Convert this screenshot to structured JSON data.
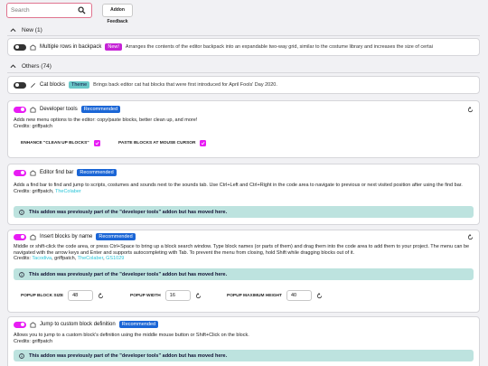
{
  "search": {
    "placeholder": "Search"
  },
  "toolbar": {
    "feedback_label": "Addon Feedback"
  },
  "sections": {
    "new_label": "New (1)",
    "others_label": "Others (74)"
  },
  "addons": [
    {
      "title": "Multiple rows in backpack",
      "badge": "New!",
      "description": "Arranges the contents of the editor backpack into an expandable two-way grid, similar to the costume library and increases the size of certain thu...",
      "enabled": false
    },
    {
      "title": "Cat blocks",
      "badge": "Theme",
      "description": "Brings back editor cat hat blocks that were first introduced for April Fools' Day 2020.",
      "enabled": false
    },
    {
      "title": "Developer tools",
      "badge": "Recommended",
      "description": "Adds new menu options to the editor: copy/paste blocks, better clean up, and more!",
      "credits": "Credits: griffpatch",
      "options": [
        {
          "label": "ENHANCE \"CLEAN UP BLOCKS\"",
          "checked": true
        },
        {
          "label": "PASTE BLOCKS AT MOUSE CURSOR",
          "checked": true
        }
      ],
      "enabled": true
    },
    {
      "title": "Editor find bar",
      "badge": "Recommended",
      "description": "Adds a find bar to find and jump to scripts, costumes and sounds next to the sounds tab. Use Ctrl+Left and Ctrl+Right in the code area to navigate to previous or next visited position after using the find bar.",
      "credits_prefix": "Credits: griffpatch, ",
      "credits_link": "TheColaber",
      "notice": "This addon was previously part of the \"developer tools\" addon but has moved here.",
      "enabled": true
    },
    {
      "title": "Insert blocks by name",
      "badge": "Recommended",
      "description": "Middle or shift-click the code area, or press Ctrl+Space to bring up a block search window. Type block names (or parts of them) and drag them into the code area to add them to your project. The menu can be navigated with the arrow keys and Enter and supports autocompleting with Tab. To prevent the menu from closing, hold Shift while dragging blocks out of it.",
      "credits_prefix": "Credits: ",
      "credits_link1": "Tacodiva",
      "credits_mid": ", griffpatch, ",
      "credits_link2": "TheColaber",
      "credits_sep": ", ",
      "credits_link3": "GS1029",
      "notice": "This addon was previously part of the \"developer tools\" addon but has moved here.",
      "options": [
        {
          "label": "POPUP BLOCK SIZE",
          "value": "48"
        },
        {
          "label": "POPUP WIDTH",
          "value": "16"
        },
        {
          "label": "POPUP MAXIMUM HEIGHT",
          "value": "40"
        }
      ],
      "enabled": true
    },
    {
      "title": "Jump to custom block definition",
      "badge": "Recommended",
      "description": "Allows you to jump to a custom block's definition using the middle mouse button or Shift+Click on the block.",
      "credits": "Credits: griffpatch",
      "notice": "This addon was previously part of the \"developer tools\" addon but has moved here.",
      "enabled": true
    }
  ],
  "colors": {
    "accent": "#e81cf4",
    "recommended": "#1b66d6",
    "notice_bg": "#bde3df",
    "link": "#29c5d8"
  }
}
